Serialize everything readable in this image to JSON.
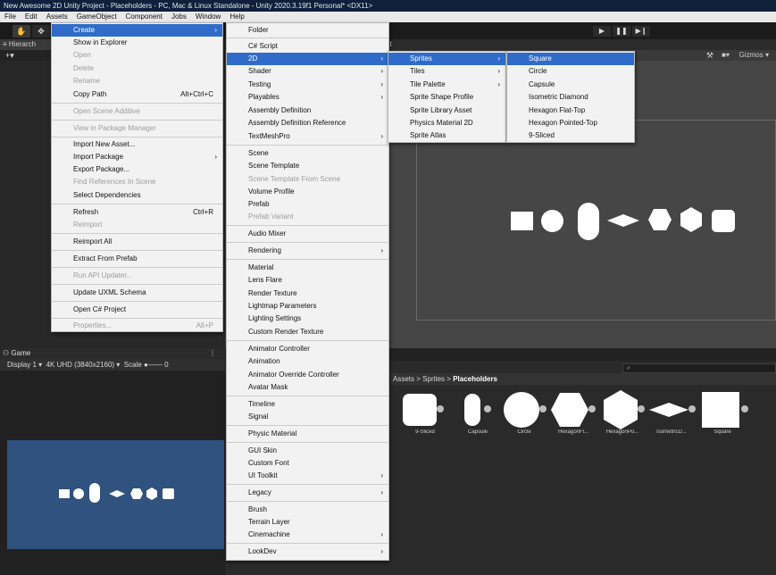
{
  "title_bar": {
    "text": "New Awesome 2D Unity Project - Placeholders - PC, Mac & Linux Standalone - Unity 2020.3.19f1 Personal* <DX11>"
  },
  "menu_bar": {
    "items": [
      "File",
      "Edit",
      "Assets",
      "GameObject",
      "Component",
      "Jobs",
      "Window",
      "Help"
    ]
  },
  "hierarchy": {
    "tab": "Hierarch"
  },
  "scene": {
    "tab_partial": "nt",
    "gizmos": "Gizmos"
  },
  "game": {
    "tab": "Game",
    "display": "Display 1",
    "resolution": "4K UHD (3840x2160)",
    "scale_label": "Scale",
    "scale_value": "0"
  },
  "project": {
    "breadcrumb": [
      "Assets",
      "Sprites"
    ],
    "breadcrumb_current": "Placeholders",
    "separator": ">",
    "search_icon": "⌕",
    "assets": [
      "9-Sliced",
      "Capsule",
      "Circle",
      "HexagonFl...",
      "HexagonPo...",
      "IsometricD...",
      "Square"
    ]
  },
  "assets_menu": {
    "items": [
      {
        "label": "Create",
        "highlighted": true,
        "submenu": true
      },
      {
        "label": "Show in Explorer"
      },
      {
        "label": "Open",
        "disabled": true
      },
      {
        "label": "Delete",
        "disabled": true
      },
      {
        "label": "Rename",
        "disabled": true
      },
      {
        "label": "Copy Path",
        "shortcut": "Alt+Ctrl+C"
      },
      {
        "label": "Open Scene Additive",
        "disabled": true
      },
      {
        "label": "View in Package Manager",
        "disabled": true
      },
      {
        "label": "Import New Asset..."
      },
      {
        "label": "Import Package",
        "submenu": true
      },
      {
        "label": "Export Package..."
      },
      {
        "label": "Find References In Scene",
        "disabled": true
      },
      {
        "label": "Select Dependencies"
      },
      {
        "label": "Refresh",
        "shortcut": "Ctrl+R"
      },
      {
        "label": "Reimport",
        "disabled": true
      },
      {
        "label": "Reimport All"
      },
      {
        "label": "Extract From Prefab"
      },
      {
        "label": "Run API Updater...",
        "disabled": true
      },
      {
        "label": "Update UXML Schema"
      },
      {
        "label": "Open C# Project"
      },
      {
        "label": "Properties...",
        "shortcut": "Alt+P",
        "disabled": true
      }
    ]
  },
  "create_menu": {
    "items": [
      {
        "label": "Folder"
      },
      {
        "label": "C# Script"
      },
      {
        "label": "2D",
        "highlighted": true,
        "submenu": true
      },
      {
        "label": "Shader",
        "submenu": true
      },
      {
        "label": "Testing",
        "submenu": true
      },
      {
        "label": "Playables",
        "submenu": true
      },
      {
        "label": "Assembly Definition"
      },
      {
        "label": "Assembly Definition Reference"
      },
      {
        "label": "TextMeshPro",
        "submenu": true
      },
      {
        "label": "Scene"
      },
      {
        "label": "Scene Template"
      },
      {
        "label": "Scene Template From Scene",
        "disabled": true
      },
      {
        "label": "Volume Profile"
      },
      {
        "label": "Prefab"
      },
      {
        "label": "Prefab Variant",
        "disabled": true
      },
      {
        "label": "Audio Mixer"
      },
      {
        "label": "Rendering",
        "submenu": true
      },
      {
        "label": "Material"
      },
      {
        "label": "Lens Flare"
      },
      {
        "label": "Render Texture"
      },
      {
        "label": "Lightmap Parameters"
      },
      {
        "label": "Lighting Settings"
      },
      {
        "label": "Custom Render Texture"
      },
      {
        "label": "Animator Controller"
      },
      {
        "label": "Animation"
      },
      {
        "label": "Animator Override Controller"
      },
      {
        "label": "Avatar Mask"
      },
      {
        "label": "Timeline"
      },
      {
        "label": "Signal"
      },
      {
        "label": "Physic Material"
      },
      {
        "label": "GUI Skin"
      },
      {
        "label": "Custom Font"
      },
      {
        "label": "UI Toolkit",
        "submenu": true
      },
      {
        "label": "Legacy",
        "submenu": true
      },
      {
        "label": "Brush"
      },
      {
        "label": "Terrain Layer"
      },
      {
        "label": "Cinemachine",
        "submenu": true
      },
      {
        "label": "LookDev",
        "submenu": true
      }
    ]
  },
  "menu_2d": {
    "items": [
      {
        "label": "Sprites",
        "highlighted": true,
        "submenu": true
      },
      {
        "label": "Tiles",
        "submenu": true
      },
      {
        "label": "Tile Palette",
        "submenu": true
      },
      {
        "label": "Sprite Shape Profile"
      },
      {
        "label": "Sprite Library Asset"
      },
      {
        "label": "Physics Material 2D"
      },
      {
        "label": "Sprite Atlas"
      }
    ]
  },
  "sprites_menu": {
    "items": [
      {
        "label": "Square",
        "highlighted": true
      },
      {
        "label": "Circle"
      },
      {
        "label": "Capsule"
      },
      {
        "label": "Isometric Diamond"
      },
      {
        "label": "Hexagon Flat-Top"
      },
      {
        "label": "Hexagon Pointed-Top"
      },
      {
        "label": "9-Sliced"
      }
    ]
  },
  "icons": {
    "arrow": "›",
    "play": "▶",
    "pause": "❚❚",
    "step": "▶❙"
  }
}
